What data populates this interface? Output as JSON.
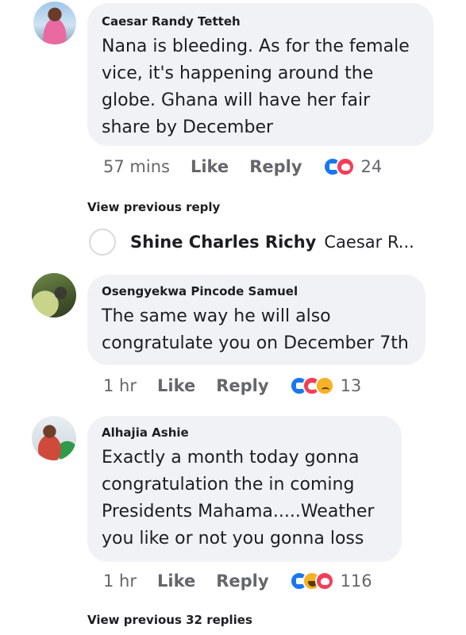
{
  "comments": [
    {
      "author": "Caesar Randy Tetteh",
      "text_lines": [
        "Nana is bleeding. As for the female",
        "vice, it's happening around the",
        "globe. Ghana will have her fair",
        "share by December"
      ],
      "time": "57 mins",
      "like_label": "Like",
      "reply_label": "Reply",
      "reactions": [
        "like-icon",
        "love-icon"
      ],
      "reaction_count": "24"
    },
    {
      "author": "Osengyekwa Pincode Samuel",
      "text_lines": [
        "The same way he will also",
        "congratulate you on December 7th"
      ],
      "time": "1 hr",
      "like_label": "Like",
      "reply_label": "Reply",
      "reactions": [
        "like-icon",
        "love-icon",
        "sad-icon"
      ],
      "reaction_count": "13"
    },
    {
      "author": "Alhajia Ashie",
      "text_lines": [
        "Exactly a month today gonna",
        "congratulation the in coming",
        "Presidents Mahama.....Weather",
        "you like or not you gonna loss"
      ],
      "time": "1 hr",
      "like_label": "Like",
      "reply_label": "Reply",
      "reactions": [
        "like-icon",
        "haha-icon",
        "love-icon"
      ],
      "reaction_count": "116"
    }
  ],
  "view_previous_reply": "View previous reply",
  "reply_preview": {
    "author": "Shine Charles Richy",
    "text": "Caesar R..."
  },
  "view_previous_replies": "View previous 32 replies",
  "colors": {
    "bubble": "#f0f2f5",
    "meta": "#65676b",
    "like_blue": "#1877f2",
    "love_red": "#f33e58",
    "emoji_yellow": "#f7b125"
  }
}
